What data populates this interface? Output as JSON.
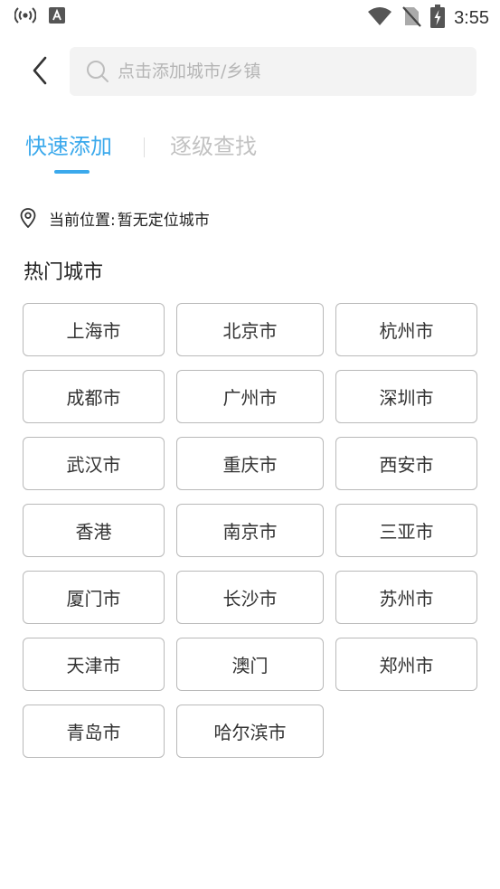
{
  "status_bar": {
    "time": "3:55",
    "icons": [
      "hotspot-icon",
      "notification-a-icon",
      "wifi-icon",
      "no-sim-icon",
      "battery-charging-icon"
    ]
  },
  "header": {
    "back_icon": "chevron-left-icon",
    "search": {
      "icon": "search-icon",
      "placeholder": "点击添加城市/乡镇",
      "value": ""
    }
  },
  "tabs": [
    {
      "label": "快速添加",
      "active": true
    },
    {
      "label": "逐级查找",
      "active": false
    }
  ],
  "location": {
    "icon": "location-pin-icon",
    "label": "当前位置:",
    "value": "暂无定位城市"
  },
  "hot_cities": {
    "title": "热门城市",
    "cities": [
      "上海市",
      "北京市",
      "杭州市",
      "成都市",
      "广州市",
      "深圳市",
      "武汉市",
      "重庆市",
      "西安市",
      "香港",
      "南京市",
      "三亚市",
      "厦门市",
      "长沙市",
      "苏州市",
      "天津市",
      "澳门",
      "郑州市",
      "青岛市",
      "哈尔滨市"
    ]
  },
  "colors": {
    "accent": "#3ba9ec",
    "inactive_tab": "#c2c2c2",
    "border": "#b9b9b9",
    "search_bg": "#f3f3f3"
  }
}
